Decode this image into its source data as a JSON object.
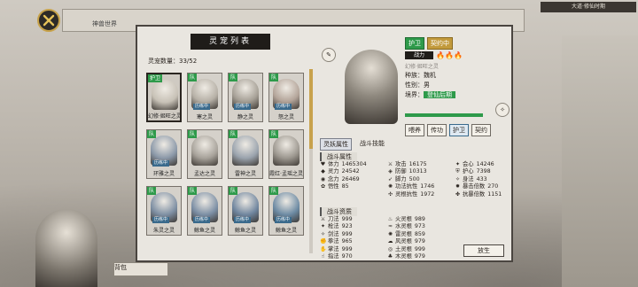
{
  "window": {
    "tab_hint": "神兽世界",
    "top_right": "大道·修仙时期"
  },
  "panel": {
    "title": "灵宠列表",
    "count_label": "灵宠数量：",
    "count": "33/52",
    "cards": [
      {
        "name": "幻修·姬旺之灵",
        "tag": "护卫",
        "tag2": "",
        "fight": "",
        "tint": "#c7c1b6",
        "selected": true
      },
      {
        "name": "寒之灵",
        "tag": "队",
        "tag2": "",
        "fight": "历练中",
        "tint": "#b6b0a6"
      },
      {
        "name": "静之灵",
        "tag": "队",
        "tag2": "",
        "fight": "历练中",
        "tint": "#a59f95"
      },
      {
        "name": "怒之灵",
        "tag": "队",
        "tag2": "",
        "fight": "历练中",
        "tint": "#b3a499"
      },
      {
        "name": "环雅之灵",
        "tag": "队",
        "tag2": "",
        "fight": "历练中",
        "tint": "#8b98a8"
      },
      {
        "name": "孟达之灵",
        "tag": "队",
        "tag2": "",
        "fight": "",
        "tint": "#a7a29a"
      },
      {
        "name": "雷神之灵",
        "tag": "队",
        "tag2": "",
        "fight": "",
        "tint": "#9aa3ad"
      },
      {
        "name": "霞红·孟瑶之灵",
        "tag": "队",
        "tag2": "",
        "fight": "",
        "tint": "#9c978f"
      },
      {
        "name": "朱灵之灵",
        "tag": "队",
        "tag2": "",
        "fight": "历练中",
        "tint": "#7e8fa3"
      },
      {
        "name": "鲸鱼之灵",
        "tag": "队",
        "tag2": "",
        "fight": "历练中",
        "tint": "#7b8ea4"
      },
      {
        "name": "鲸鱼之灵",
        "tag": "队",
        "tag2": "",
        "fight": "历练中",
        "tint": "#6f859e"
      },
      {
        "name": "鲸鱼之灵",
        "tag": "队",
        "tag2": "",
        "fight": "历练中",
        "tint": "#6c8aa3"
      }
    ]
  },
  "detail": {
    "roles": [
      "护卫",
      "契约中"
    ],
    "power_label": "战力",
    "flames": "🔥🔥🔥",
    "subtitle": "幻修·姬旺之灵",
    "race_label": "种族：",
    "race": "魏机",
    "gender_label": "性别：",
    "gender": "男",
    "realm_label": "境界：",
    "realm": "登仙后期",
    "actions": [
      "喂养",
      "传功",
      "护卫",
      "契约"
    ],
    "stat_tabs": [
      "灵妖属性",
      "战斗技能"
    ],
    "section_attr": "战斗属性",
    "section_skill": "战斗资质",
    "release": "放生",
    "stats": [
      {
        "icon": "♥",
        "label": "体力",
        "value": "1465304"
      },
      {
        "icon": "⚔",
        "label": "攻击",
        "value": "16175"
      },
      {
        "icon": "✦",
        "label": "会心",
        "value": "14246"
      },
      {
        "icon": "◆",
        "label": "灵力",
        "value": "24542"
      },
      {
        "icon": "◈",
        "label": "防御",
        "value": "10313"
      },
      {
        "icon": "⛨",
        "label": "护心",
        "value": "7398"
      },
      {
        "icon": "◉",
        "label": "念力",
        "value": "26469"
      },
      {
        "icon": "➶",
        "label": "脚力",
        "value": "500"
      },
      {
        "icon": "✧",
        "label": "身法",
        "value": "433"
      },
      {
        "icon": "✿",
        "label": "悟性",
        "value": "85"
      },
      {
        "icon": "✺",
        "label": "功法抗性",
        "value": "1746"
      },
      {
        "icon": "✹",
        "label": "暴击倍数",
        "value": "270"
      },
      {
        "icon": "",
        "label": "",
        "value": ""
      },
      {
        "icon": "✣",
        "label": "灵根抗性",
        "value": "1972"
      },
      {
        "icon": "✤",
        "label": "抗暴倍数",
        "value": "1151"
      }
    ],
    "skills": [
      {
        "icon": "⚔",
        "label": "刀法",
        "value": "999"
      },
      {
        "icon": "♨",
        "label": "火灵根",
        "value": "989"
      },
      {
        "icon": "✦",
        "label": "枪法",
        "value": "923"
      },
      {
        "icon": "≈",
        "label": "水灵根",
        "value": "973"
      },
      {
        "icon": "✧",
        "label": "剑法",
        "value": "999"
      },
      {
        "icon": "✺",
        "label": "雷灵根",
        "value": "859"
      },
      {
        "icon": "✊",
        "label": "拳法",
        "value": "965"
      },
      {
        "icon": "☁",
        "label": "风灵根",
        "value": "979"
      },
      {
        "icon": "✋",
        "label": "掌法",
        "value": "999"
      },
      {
        "icon": "◎",
        "label": "土灵根",
        "value": "999"
      },
      {
        "icon": "☝",
        "label": "指法",
        "value": "970"
      },
      {
        "icon": "♣",
        "label": "木灵根",
        "value": "979"
      }
    ]
  },
  "bottom": {
    "left_btn": "背包"
  }
}
